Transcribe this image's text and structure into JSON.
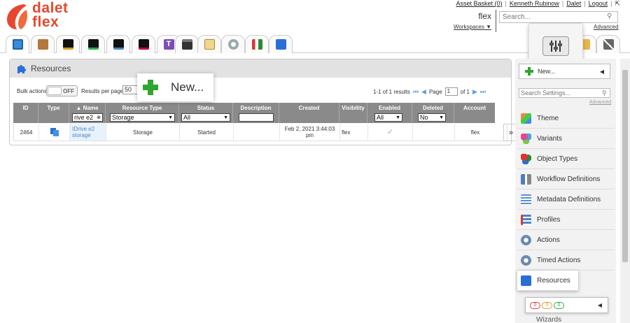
{
  "brand": {
    "line1": "dalet",
    "line2": "flex",
    "color": "#e8472f"
  },
  "toplinks": [
    "Asset Basket (0)",
    "Kenneth Rubinow",
    "Dalet",
    "Logout"
  ],
  "account": {
    "name": "flex",
    "workspaces_label": "Workspaces"
  },
  "search": {
    "placeholder": "Search...",
    "advanced_label": "Advanced"
  },
  "tabs": [
    {
      "icon": "browse-icon"
    },
    {
      "icon": "box-icon"
    },
    {
      "icon": "graph-icon-1"
    },
    {
      "icon": "graph-icon-2"
    },
    {
      "icon": "graph-icon-3"
    },
    {
      "icon": "graph-icon-4"
    },
    {
      "icon": "t-icon"
    },
    {
      "icon": "clapper-icon"
    },
    {
      "icon": "clipboard-icon"
    },
    {
      "icon": "gear-icon"
    },
    {
      "icon": "workflow-icon"
    },
    {
      "icon": "puzzle-icon"
    }
  ],
  "panel": {
    "title": "Resources",
    "bulk_label": "Bulk actions",
    "toggle_label": "OFF",
    "results_per_page_label": "Results per page",
    "results_per_page_value": "50",
    "new_label": "New...",
    "pager": {
      "results": "1-1 of 1 results",
      "page_label": "Page",
      "page_value": "1",
      "of_label": "of 1"
    }
  },
  "table": {
    "columns": [
      "ID",
      "Type",
      "▲ Name",
      "Resource Type",
      "Status",
      "Description",
      "Created",
      "Visibility",
      "Enabled",
      "Deleted",
      "Account"
    ],
    "filters": {
      "name": "rive e2",
      "resource_type": "Storage",
      "status": "All",
      "description": "",
      "enabled": "All",
      "deleted": "No"
    },
    "row": {
      "id": "2464",
      "name_line1": "IDrive e2",
      "name_line2": "storage",
      "resource_type": "Storage",
      "status": "Started",
      "description": "",
      "created_line1": "Feb 2, 2021 3:44:03",
      "created_line2": "pm",
      "visibility": "flex",
      "enabled": "✓",
      "deleted": "",
      "account": "flex"
    },
    "more": "»"
  },
  "sidebar": {
    "new_label": "New...",
    "search_placeholder": "Search Settings...",
    "advanced_label": "Advanced",
    "items": [
      {
        "label": "Theme",
        "icon": "theme-icon",
        "color": "#4aa3df"
      },
      {
        "label": "Variants",
        "icon": "variants-icon",
        "color": "#e04a8a"
      },
      {
        "label": "Object Types",
        "icon": "object-types-icon",
        "color": "#d33"
      },
      {
        "label": "Workflow Definitions",
        "icon": "workflow-icon",
        "color": "#4a7fc1"
      },
      {
        "label": "Metadata Definitions",
        "icon": "metadata-icon",
        "color": "#5a8fd0"
      },
      {
        "label": "Profiles",
        "icon": "profiles-icon",
        "color": "#4a86c5"
      },
      {
        "label": "Actions",
        "icon": "gear-icon",
        "color": "#6b8bb0"
      },
      {
        "label": "Timed Actions",
        "icon": "gear-icon",
        "color": "#6b8bb0"
      },
      {
        "label": "Resources",
        "icon": "puzzle-icon",
        "color": "#2a6fd6"
      }
    ],
    "status_pills": [
      "0",
      "0",
      "0"
    ],
    "wizards_label": "Wizards"
  }
}
